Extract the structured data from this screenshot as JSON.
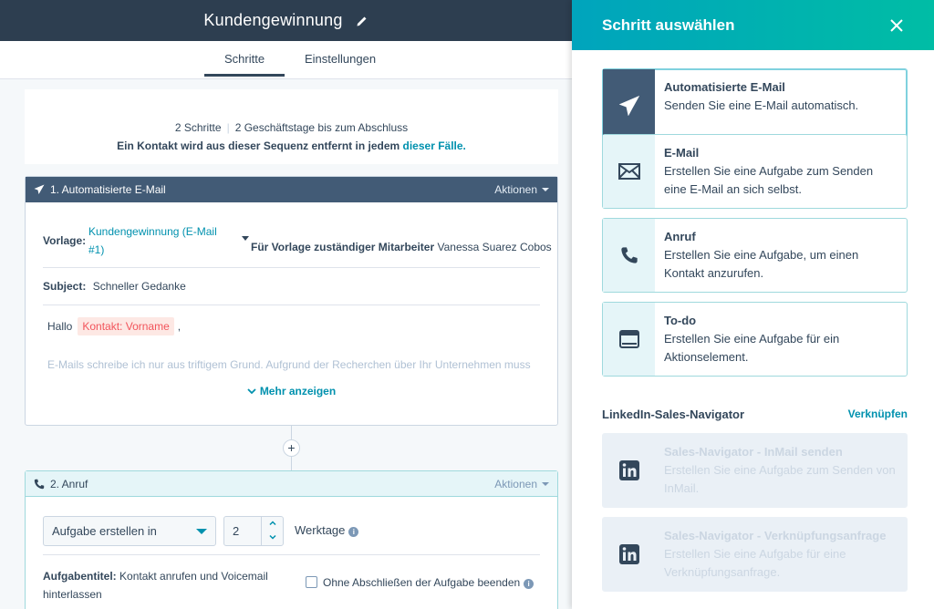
{
  "editor": {
    "title": "Kundengewinnung",
    "tabs": [
      "Schritte",
      "Einstellungen"
    ],
    "summary": {
      "steps": "2 Schritte",
      "days": "2 Geschäftstage bis zum Abschluss",
      "removal_text": "Ein Kontakt wird aus dieser Sequenz entfernt in jedem",
      "removal_link": "dieser Fälle."
    },
    "step1": {
      "header": "1. Automatisierte E-Mail",
      "actions": "Aktionen",
      "template_label": "Vorlage:",
      "template_value": "Kundengewinnung (E-Mail #1)",
      "owner_label": "Für Vorlage zuständiger Mitarbeiter",
      "owner_value": "Vanessa Suarez Cobos",
      "subject_label": "Subject:",
      "subject_value": "Schneller Gedanke",
      "greeting": "Hallo",
      "token": "Kontakt: Vorname",
      "greeting_end": ",",
      "body_preview": "E-Mails schreibe ich nur aus triftigem Grund. Aufgrund der Recherchen über Ihr Unternehmen muss",
      "show_more": "Mehr anzeigen"
    },
    "step2": {
      "header": "2. Anruf",
      "actions": "Aktionen",
      "select_value": "Aufgabe erstellen in",
      "stepper_value": "2",
      "unit": "Werktage",
      "task_title_label": "Aufgabentitel:",
      "task_title_value": "Kontakt anrufen und Voicemail hinterlassen",
      "checkbox_label": "Ohne Abschließen der Aufgabe beenden"
    }
  },
  "panel": {
    "title": "Schritt auswählen",
    "cards": [
      {
        "title": "Automatisierte E-Mail",
        "desc": "Senden Sie eine E-Mail automatisch.",
        "icon": "paper-plane-icon",
        "state": "selected"
      },
      {
        "title": "E-Mail",
        "desc": "Erstellen Sie eine Aufgabe zum Senden eine E-Mail an sich selbst.",
        "icon": "envelope-icon",
        "state": "normal"
      },
      {
        "title": "Anruf",
        "desc": "Erstellen Sie eine Aufgabe, um einen Kontakt anzurufen.",
        "icon": "phone-icon",
        "state": "normal"
      },
      {
        "title": "To-do",
        "desc": "Erstellen Sie eine Aufgabe für ein Aktionselement.",
        "icon": "todo-icon",
        "state": "normal"
      }
    ],
    "linkedin": {
      "heading": "LinkedIn-Sales-Navigator",
      "connect": "Verknüpfen",
      "cards": [
        {
          "title": "Sales-Navigator - InMail senden",
          "desc": "Erstellen Sie eine Aufgabe zum Senden von InMail.",
          "icon": "linkedin-icon",
          "state": "disabled"
        },
        {
          "title": "Sales-Navigator - Verknüpfungsanfrage",
          "desc": "Erstellen Sie eine Aufgabe für eine Verknüpfungsanfrage.",
          "icon": "linkedin-icon",
          "state": "disabled"
        }
      ]
    }
  },
  "colors": {
    "header_dark": "#2d3e50",
    "step_header": "#425b76",
    "accent": "#0091ae",
    "panel_gradient_start": "#00a4bd",
    "panel_gradient_end": "#00bda5",
    "token_bg": "#fde8e4",
    "token_text": "#f2545b"
  }
}
